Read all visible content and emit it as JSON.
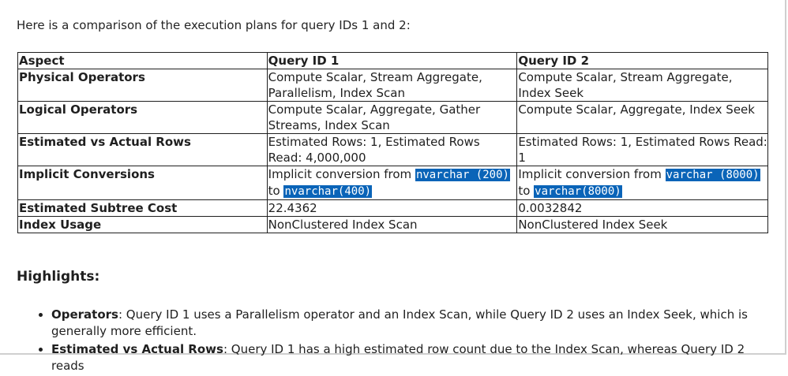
{
  "intro": "Here is a comparison of the execution plans for query IDs 1 and 2:",
  "table": {
    "headers": [
      "Aspect",
      "Query ID 1",
      "Query ID 2"
    ],
    "rows": [
      {
        "aspect": "Physical Operators",
        "q1": "Compute Scalar, Stream Aggregate, Parallelism, Index Scan",
        "q2": "Compute Scalar, Stream Aggregate, Index Seek"
      },
      {
        "aspect": "Logical Operators",
        "q1": "Compute Scalar, Aggregate, Gather Streams, Index Scan",
        "q2": "Compute Scalar, Aggregate, Index Seek"
      },
      {
        "aspect": "Estimated vs Actual Rows",
        "q1": "Estimated Rows: 1, Estimated Rows Read: 4,000,000",
        "q2": "Estimated Rows: 1, Estimated Rows Read: 1"
      },
      {
        "aspect": "Implicit Conversions",
        "q1": {
          "prefix": "Implicit conversion from ",
          "from_type": "nvarchar (200)",
          "mid": " to ",
          "to_type": "nvarchar(400)"
        },
        "q2": {
          "prefix": "Implicit conversion from ",
          "from_type": "varchar (8000)",
          "mid": " to ",
          "to_type": "varchar(8000)"
        }
      },
      {
        "aspect": "Estimated Subtree Cost",
        "q1": "22.4362",
        "q2": "0.0032842"
      },
      {
        "aspect": "Index Usage",
        "q1": "NonClustered Index Scan",
        "q2": "NonClustered Index Seek"
      }
    ]
  },
  "highlights": {
    "title": "Highlights:",
    "items": [
      {
        "label": "Operators",
        "text": ": Query ID 1 uses a Parallelism operator and an Index Scan, while Query ID 2 uses an Index Seek, which is generally more efficient."
      },
      {
        "label": "Estimated vs Actual Rows",
        "text": ": Query ID 1 has a high estimated row count due to the Index Scan, whereas Query ID 2 reads"
      }
    ]
  },
  "colors": {
    "code_highlight_bg": "#0a64b8",
    "code_highlight_fg": "#ffffff",
    "table_border": "#1f1f1f"
  }
}
